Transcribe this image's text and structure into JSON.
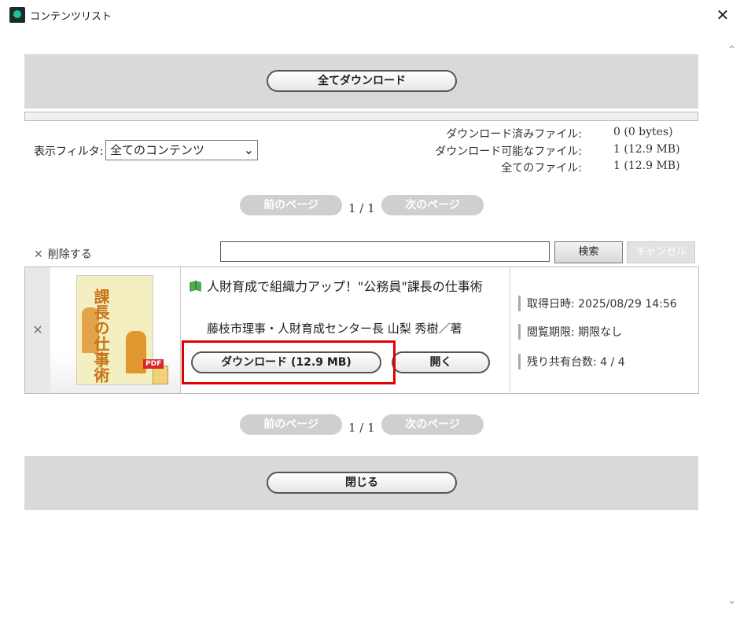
{
  "window": {
    "title": "コンテンツリスト",
    "close_glyph": "✕"
  },
  "toolbar": {
    "download_all_label": "全てダウンロード"
  },
  "filter": {
    "label": "表示フィルタ:",
    "selected": "全てのコンテンツ"
  },
  "stats": [
    {
      "label": "ダウンロード済みファイル:",
      "value": "0  (0 bytes)"
    },
    {
      "label": "ダウンロード可能なファイル:",
      "value": "1  (12.9 MB)"
    },
    {
      "label": "全てのファイル:",
      "value": "1  (12.9 MB)"
    }
  ],
  "pager": {
    "prev_label": "前のページ",
    "next_label": "次のページ",
    "indicator": "1 / 1"
  },
  "list_controls": {
    "delete_label": "削除する",
    "search_value": "",
    "search_label": "検索",
    "cancel_label": "キャンセル"
  },
  "item": {
    "title": "人財育成で組織力アップ！\"公務員\"課長の仕事術",
    "author": "藤枝市理事・人財育成センター長  山梨  秀樹／著",
    "cover_text": "課長の仕事術",
    "format_badge": "PDF",
    "download_label": "ダウンロード (12.9 MB)",
    "open_label": "開く",
    "acquired": "取得日時: 2025/08/29 14:56",
    "expiry": "閲覧期限: 期限なし",
    "shares": "残り共有台数: 4 / 4"
  },
  "footer": {
    "close_label": "閉じる"
  },
  "colors": {
    "highlight": "#e00000",
    "panel": "#d9d9d9",
    "disabled_button": "#cfcfcf"
  }
}
